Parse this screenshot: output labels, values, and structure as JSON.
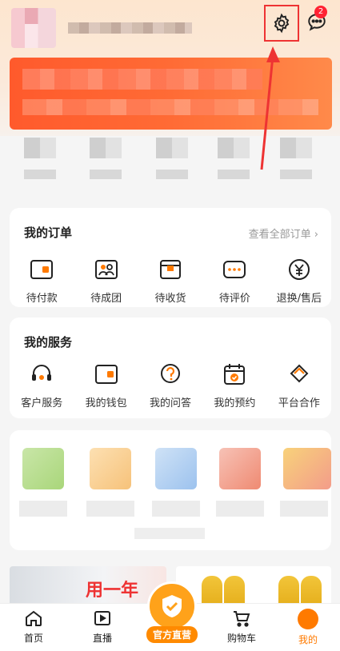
{
  "header": {
    "notification_count": "2"
  },
  "orders": {
    "title": "我的订单",
    "view_all": "查看全部订单 ›",
    "items": [
      {
        "label": "待付款",
        "icon": "wallet-icon"
      },
      {
        "label": "待成团",
        "icon": "group-icon"
      },
      {
        "label": "待收货",
        "icon": "package-icon"
      },
      {
        "label": "待评价",
        "icon": "comment-icon"
      },
      {
        "label": "退换/售后",
        "icon": "refund-icon"
      }
    ]
  },
  "services": {
    "title": "我的服务",
    "items": [
      {
        "label": "客户服务",
        "icon": "headset-icon"
      },
      {
        "label": "我的钱包",
        "icon": "wallet-icon"
      },
      {
        "label": "我的问答",
        "icon": "question-icon"
      },
      {
        "label": "我的预约",
        "icon": "calendar-icon"
      },
      {
        "label": "平台合作",
        "icon": "handshake-icon"
      }
    ]
  },
  "promo": {
    "left_text": "用一年"
  },
  "tabbar": {
    "items": [
      {
        "label": "首页",
        "icon": "home-icon"
      },
      {
        "label": "直播",
        "icon": "video-icon"
      },
      {
        "label": "官方直营",
        "icon": "shield-check-icon"
      },
      {
        "label": "购物车",
        "icon": "cart-icon"
      },
      {
        "label": "我的",
        "icon": "profile-icon"
      }
    ]
  },
  "colors": {
    "accent": "#ff7a00",
    "highlight_box": "#ee3333",
    "banner": "#ff6b35"
  }
}
